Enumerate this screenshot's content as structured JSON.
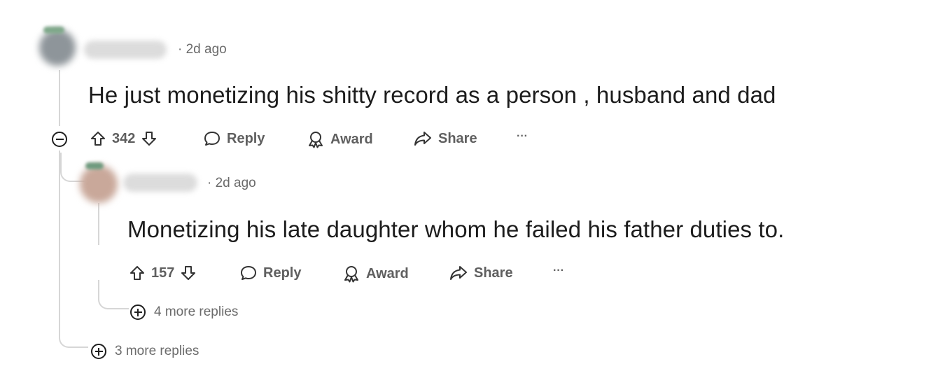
{
  "comments": [
    {
      "timestamp": "· 2d ago",
      "text": "He just monetizing his shitty record as a person , husband and dad",
      "vote_count": "342",
      "reply_label": "Reply",
      "award_label": "Award",
      "share_label": "Share",
      "more_label": "···",
      "avatar_color": "#8e959a"
    },
    {
      "timestamp": "· 2d ago",
      "text": "Monetizing his late daughter whom he failed his father duties to.",
      "vote_count": "157",
      "reply_label": "Reply",
      "award_label": "Award",
      "share_label": "Share",
      "more_label": "···",
      "avatar_color": "#c9a89a"
    }
  ],
  "nested_more_replies": "4 more replies",
  "top_more_replies": "3 more replies",
  "icons": {
    "collapse": "minus-circle-icon",
    "expand": "plus-circle-icon",
    "upvote": "arrow-up-outline-icon",
    "downvote": "arrow-down-outline-icon",
    "reply": "speech-bubble-icon",
    "award": "award-ribbon-icon",
    "share": "share-arrow-icon"
  },
  "colors": {
    "text_primary": "#1c1c1c",
    "text_secondary": "#6b6b6b",
    "thread_line": "#d6d6d6"
  }
}
